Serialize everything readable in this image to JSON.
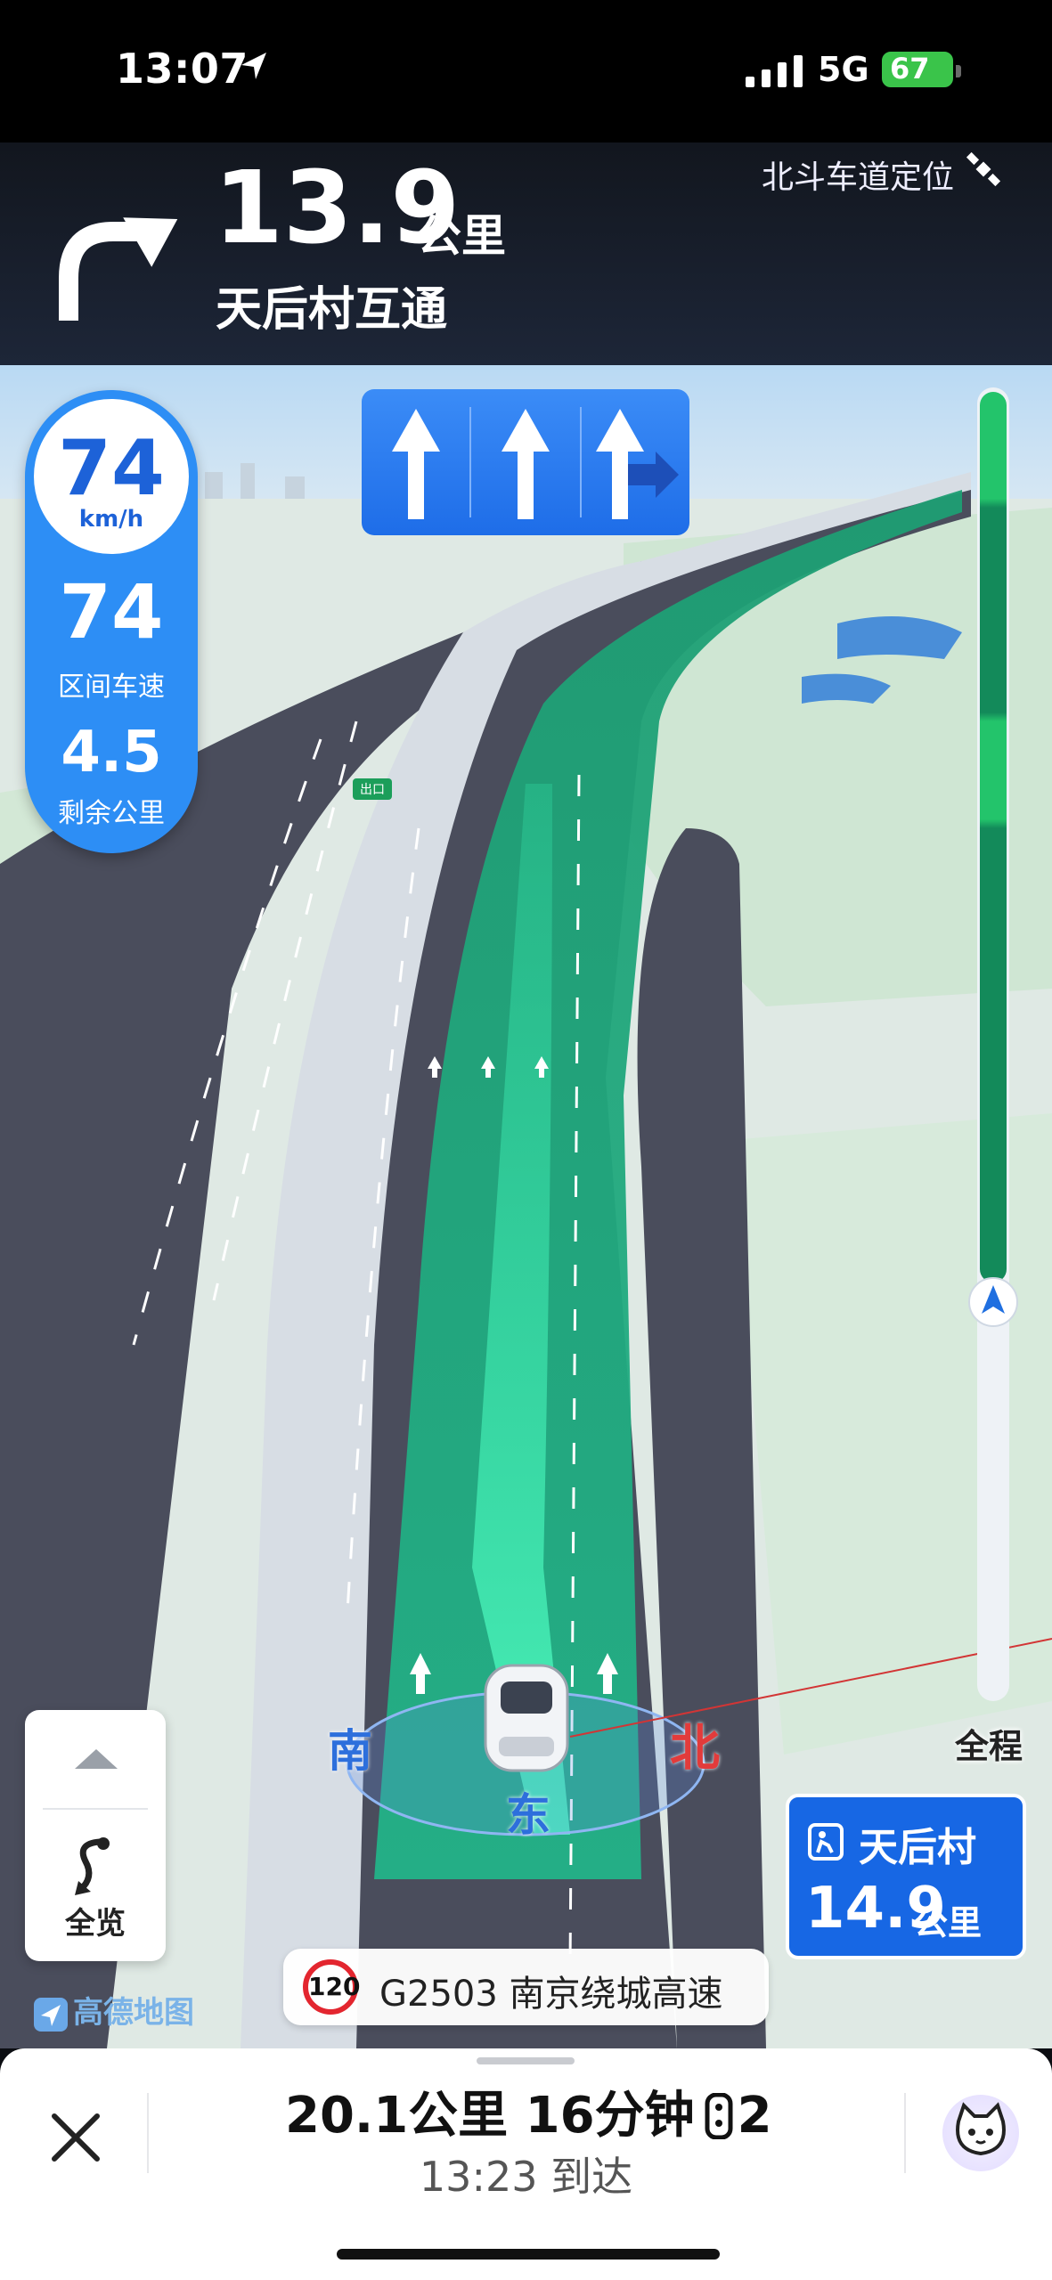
{
  "status_bar": {
    "time": "13:07",
    "network": "5G",
    "battery": "67"
  },
  "guidance": {
    "distance": "13.9",
    "distance_unit": "公里",
    "road_name": "天后村互通",
    "positioning": "北斗车道定位",
    "turn_icon": "turn-right-arrow-icon"
  },
  "speed_panel": {
    "current_speed": "74",
    "speed_unit": "km/h",
    "avg_speed": "74",
    "avg_label": "区间车速",
    "remaining": "4.5",
    "remaining_label": "剩余公里"
  },
  "lanes": [
    "straight",
    "straight",
    "straight-right"
  ],
  "map": {
    "exit_sign": "出口",
    "compass": {
      "south": "南",
      "north": "北",
      "east": "东"
    },
    "colors": {
      "route": "#2fd6a0",
      "lane_panel": "#2a7bf0",
      "limit_ring": "#e3262f"
    }
  },
  "progress": {
    "label": "全程",
    "traveled_fraction": 0.42
  },
  "overview": {
    "label": "全览"
  },
  "logo": "高德地图",
  "road_chip": {
    "speed_limit": "120",
    "road": "G2503 南京绕城高速"
  },
  "destination": {
    "name": "天后村",
    "distance": "14.9",
    "unit": "公里"
  },
  "trip": {
    "summary": "20.1公里 16分钟",
    "traffic_lights": "2",
    "arrival": "13:23 到达"
  }
}
